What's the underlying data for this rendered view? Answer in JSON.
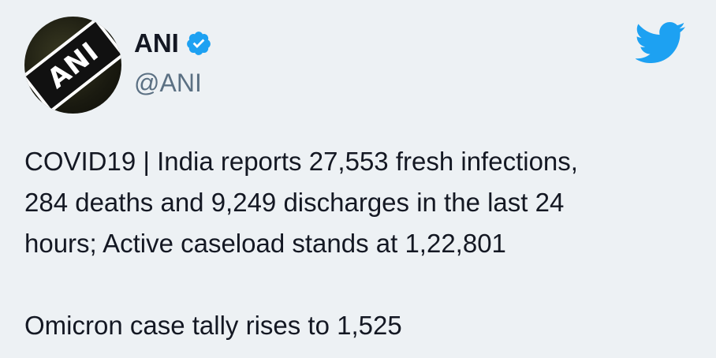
{
  "author": {
    "display_name": "ANI",
    "handle": "@ANI",
    "avatar_logo_text": "ANI",
    "verified": true
  },
  "tweet": {
    "lines": [
      "COVID19 | India reports 27,553 fresh infections,",
      "284 deaths and 9,249 discharges in the last 24",
      "hours; Active caseload stands at 1,22,801"
    ],
    "second_paragraph": "Omicron case tally rises to 1,525"
  },
  "icons": {
    "verified": "verified-badge-icon",
    "brand": "twitter-bird-icon"
  },
  "colors": {
    "background": "#edf1f4",
    "brand_blue": "#1da1f2",
    "text": "#141823",
    "secondary_text": "#5b7083"
  }
}
